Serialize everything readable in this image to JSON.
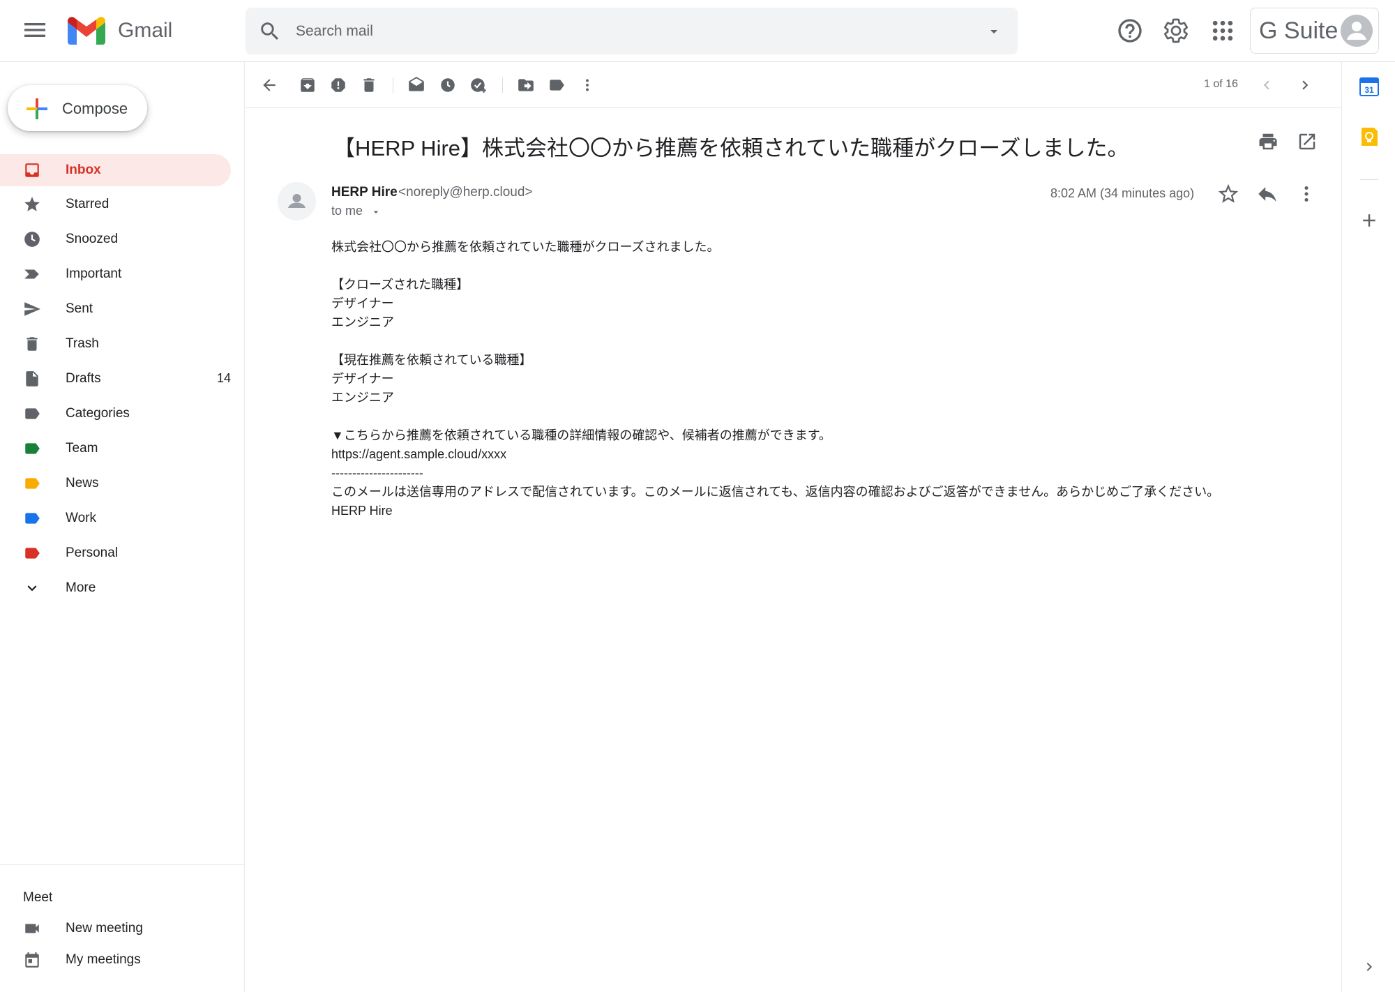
{
  "header": {
    "app_name": "Gmail",
    "search_placeholder": "Search mail",
    "brand": "G Suite"
  },
  "sidebar": {
    "compose_label": "Compose",
    "items": [
      {
        "label": "Inbox",
        "count": "",
        "icon": "inbox-icon",
        "active": true
      },
      {
        "label": "Starred",
        "count": "",
        "icon": "star-icon"
      },
      {
        "label": "Snoozed",
        "count": "",
        "icon": "clock-icon"
      },
      {
        "label": "Important",
        "count": "",
        "icon": "important-icon"
      },
      {
        "label": "Sent",
        "count": "",
        "icon": "send-icon"
      },
      {
        "label": "Trash",
        "count": "",
        "icon": "trash-icon"
      },
      {
        "label": "Drafts",
        "count": "14",
        "icon": "draft-icon"
      },
      {
        "label": "Categories",
        "count": "",
        "icon": "label-icon"
      },
      {
        "label": "Team",
        "count": "",
        "icon": "label-icon",
        "color": "#188038"
      },
      {
        "label": "News",
        "count": "",
        "icon": "label-icon",
        "color": "#f9ab00"
      },
      {
        "label": "Work",
        "count": "",
        "icon": "label-icon",
        "color": "#1a73e8"
      },
      {
        "label": "Personal",
        "count": "",
        "icon": "label-icon",
        "color": "#d93025"
      },
      {
        "label": "More",
        "count": "",
        "icon": "chevron-down-icon"
      }
    ],
    "meet": {
      "title": "Meet",
      "new_meeting": "New meeting",
      "my_meetings": "My meetings"
    }
  },
  "toolbar": {
    "pager": "1 of 16"
  },
  "email": {
    "subject": "【HERP Hire】株式会社〇〇から推薦を依頼されていた職種がクローズしました。",
    "sender_name": "HERP Hire",
    "sender_email": "<noreply@herp.cloud>",
    "to": "to me",
    "timestamp": "8:02 AM (34 minutes ago)",
    "body_lines": [
      "株式会社〇〇から推薦を依頼されていた職種がクローズされました。",
      "",
      "【クローズされた職種】",
      "デザイナー",
      "エンジニア",
      "",
      "【現在推薦を依頼されている職種】",
      "デザイナー",
      "エンジニア",
      "",
      "▼こちらから推薦を依頼されている職種の詳細情報の確認や、候補者の推薦ができます。",
      "https://agent.sample.cloud/xxxx",
      "----------------------",
      "このメールは送信専用のアドレスで配信されています。このメールに返信されても、返信内容の確認およびご返答ができません。あらかじめご了承ください。",
      "HERP Hire"
    ]
  },
  "right_panel": {
    "calendar_day": "31"
  },
  "colors": {
    "accent": "#d93025",
    "active_bg": "#fce8e6",
    "team": "#188038",
    "news": "#f9ab00",
    "work": "#1a73e8",
    "personal": "#d93025"
  }
}
